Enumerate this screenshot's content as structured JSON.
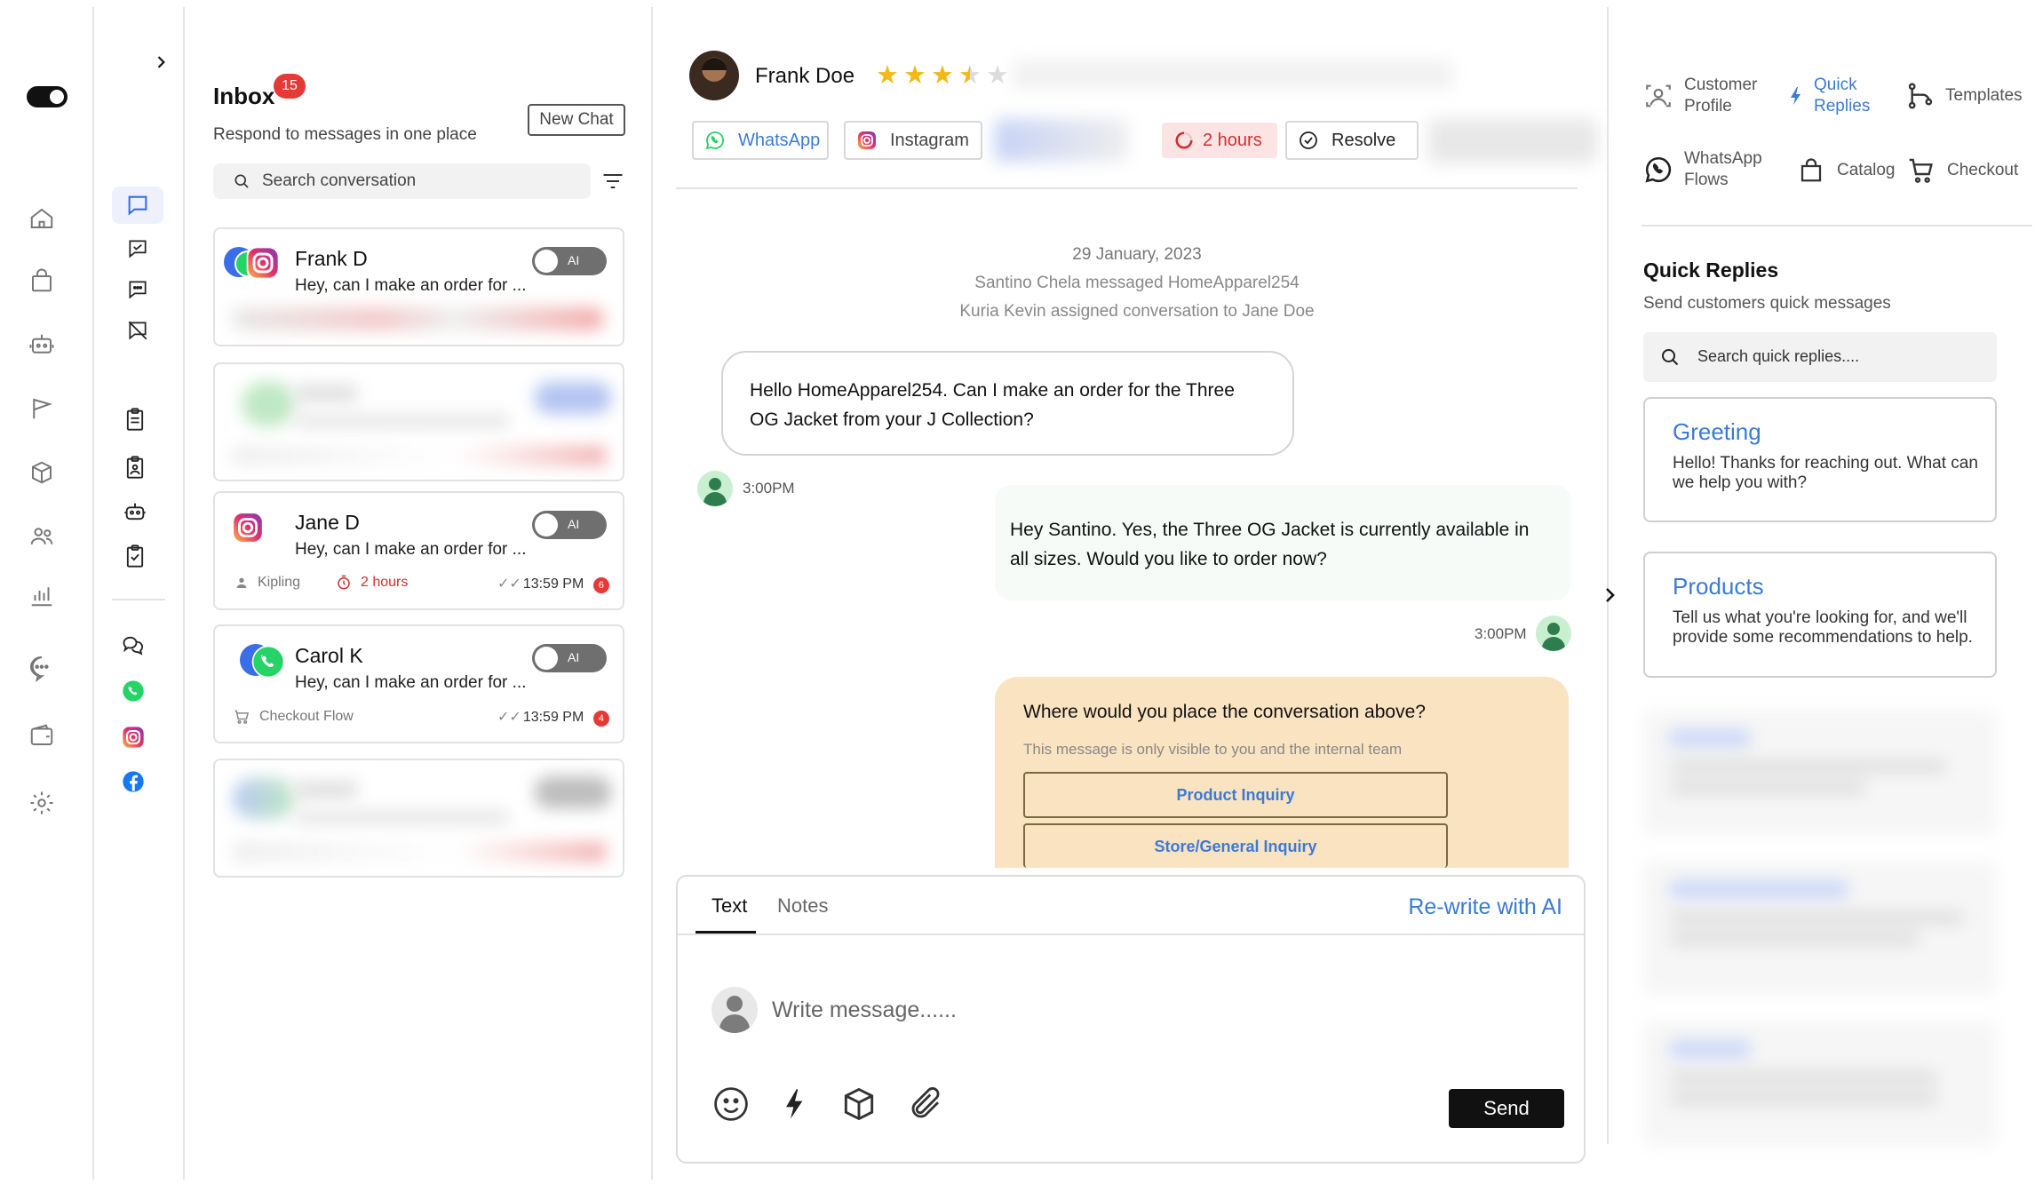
{
  "inbox": {
    "title": "Inbox",
    "count": "15",
    "new_chat": "New Chat",
    "subtitle": "Respond to messages in one place",
    "search_placeholder": "Search  conversation"
  },
  "conversations": [
    {
      "name": "Frank D",
      "preview": "Hey, can I make an order for ...",
      "ai": "AI"
    },
    {
      "name": "Jane D",
      "preview": "Hey, can I make an order for ...",
      "ai": "AI",
      "agent": "Kipling",
      "sla": "2 hours",
      "time": "13:59 PM",
      "unread": "6"
    },
    {
      "name": "Carol K",
      "preview": "Hey, can I make an order for ...",
      "ai": "AI",
      "flow": "Checkout Flow",
      "time": "13:59 PM",
      "unread": "4"
    }
  ],
  "chat": {
    "contact_name": "Frank Doe",
    "rating": 3.5,
    "channels": {
      "whatsapp": "WhatsApp",
      "instagram": "Instagram"
    },
    "sla": "2 hours",
    "resolve": "Resolve",
    "date": "29 January, 2023",
    "events": [
      "Santino Chela messaged HomeApparel254",
      "Kuria Kevin assigned conversation to Jane Doe"
    ],
    "incoming_message": "Hello HomeApparel254. Can I make an order for the Three OG Jacket from your J Collection?",
    "incoming_time": "3:00PM",
    "outgoing_message": "Hey Santino. Yes, the Three OG Jacket is currently available in all sizes. Would you like to order now?",
    "outgoing_time": "3:00PM",
    "classify": {
      "question": "Where would you place the conversation above?",
      "note": "This message is only visible to you and the internal team",
      "options": [
        "Product Inquiry",
        "Store/General Inquiry"
      ]
    }
  },
  "composer": {
    "tab_text": "Text",
    "tab_notes": "Notes",
    "rewrite": "Re-write with AI",
    "placeholder": "Write message......",
    "send": "Send"
  },
  "tools": {
    "customer_profile": "Customer Profile",
    "quick_replies": "Quick Replies",
    "templates": "Templates",
    "whatsapp_flows": "WhatsApp Flows",
    "catalog": "Catalog",
    "checkout": "Checkout"
  },
  "quick_replies": {
    "title": "Quick Replies",
    "subtitle": "Send customers quick messages",
    "search_placeholder": "Search  quick replies....",
    "items": [
      {
        "title": "Greeting",
        "body": "Hello! Thanks for reaching out. What can we help you with?"
      },
      {
        "title": "Products",
        "body": "Tell us what you're looking for, and we'll provide some recommendations to help."
      }
    ]
  },
  "colors": {
    "accent": "#3a7bd5",
    "danger": "#e53935",
    "sla_bg": "#fde4e4",
    "classify_bg": "#fae3c0",
    "outgoing_bg": "#f6fbf8"
  }
}
